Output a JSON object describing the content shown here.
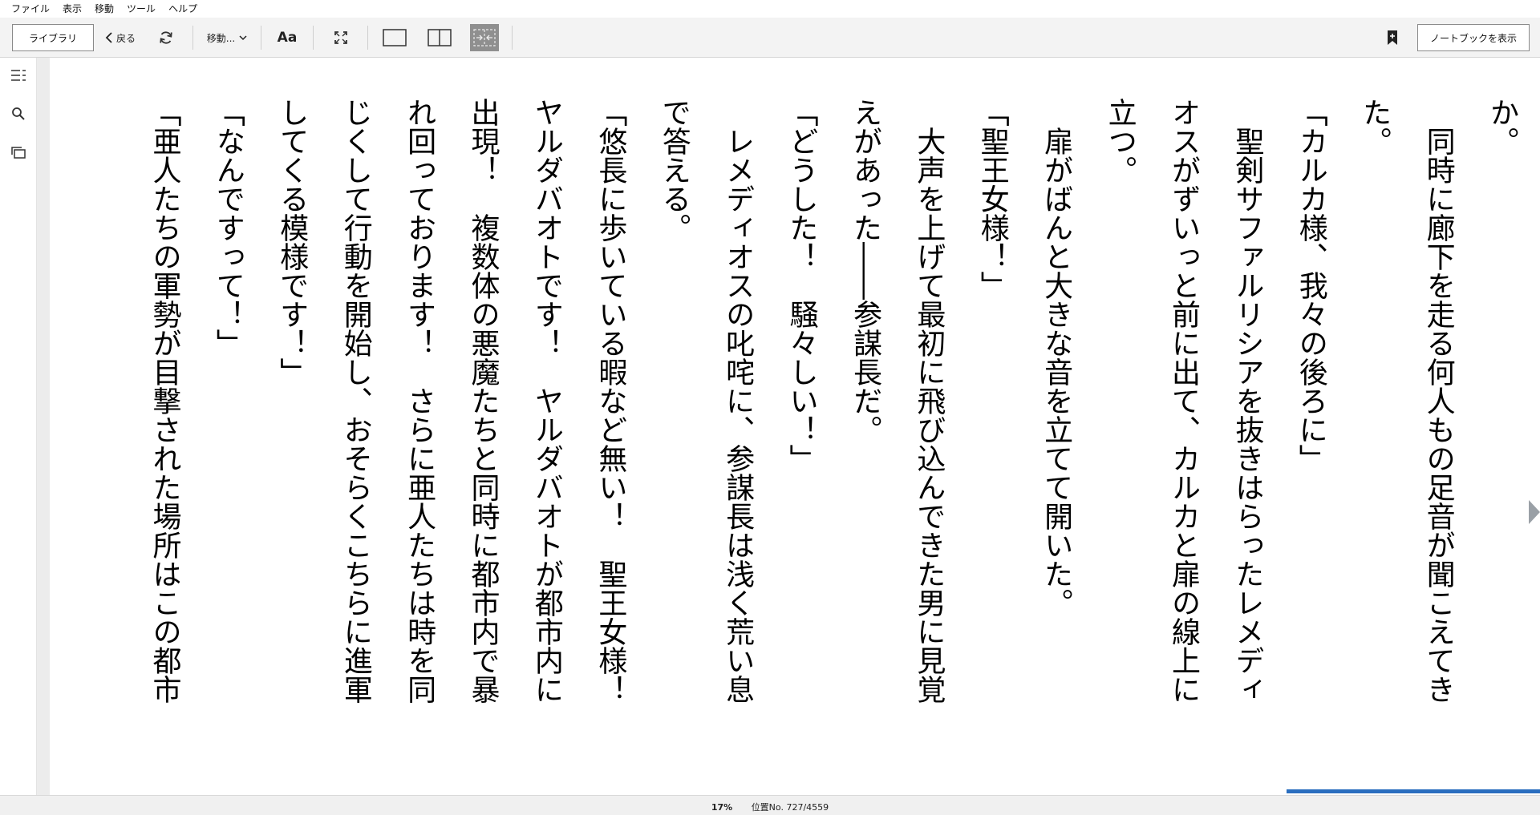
{
  "menu": [
    "ファイル",
    "表示",
    "移動",
    "ツール",
    "ヘルプ"
  ],
  "toolbar": {
    "library_label": "ライブラリ",
    "back_label": "戻る",
    "goto_label": "移動...",
    "font_label": "Aa",
    "notebook_label": "ノートブックを表示"
  },
  "colors": {
    "accent": "#2a6ebf",
    "toolbar_bg": "#f3f3f3",
    "active_layout_bg": "#8f8f8f"
  },
  "icons": {
    "back": "chevron-left-icon",
    "sync": "refresh-icon",
    "goto_caret": "chevron-down-icon",
    "fullscreen": "expand-icon",
    "single_page": "single-column-icon",
    "two_page": "two-column-icon",
    "fit_width": "fit-width-icon",
    "bookmark": "bookmark-add-icon",
    "toc": "table-of-contents-icon",
    "search": "search-icon",
    "flashcards": "stacked-cards-icon",
    "next_page": "next-page-arrow-icon"
  },
  "book": {
    "paragraphs": [
      "か。",
      "　同時に廊下を走る何人もの足音が聞こえてき",
      "た。",
      "「カルカ様、我々の後ろに」",
      "　聖剣サファルリシアを抜きはらったレメディ",
      "オスがずいっと前に出て、カルカと扉の線上に",
      "立つ。",
      "　扉がばんと大きな音を立てて開いた。",
      "「聖王女様！」",
      "　大声を上げて最初に飛び込んできた男に見覚",
      "えがあった――参謀長だ。",
      "「どうした！　騒々しい！」",
      "　レメディオスの叱咤に、参謀長は浅く荒い息",
      "で答える。",
      "「悠長に歩いている暇など無い！　聖王女様！",
      "ヤルダバオトです！　ヤルダバオトが都市内に",
      "出現！　複数体の悪魔たちと同時に都市内で暴",
      "れ回っております！　さらに亜人たちは時を同",
      "じくして行動を開始し、おそらくこちらに進軍",
      "してくる模様です！」",
      "「なんですって！」",
      "「亜人たちの軍勢が目撃された場所はこの都市"
    ]
  },
  "status": {
    "percent": "17%",
    "location": "位置No. 727/4559",
    "progress_fraction": 0.17
  }
}
